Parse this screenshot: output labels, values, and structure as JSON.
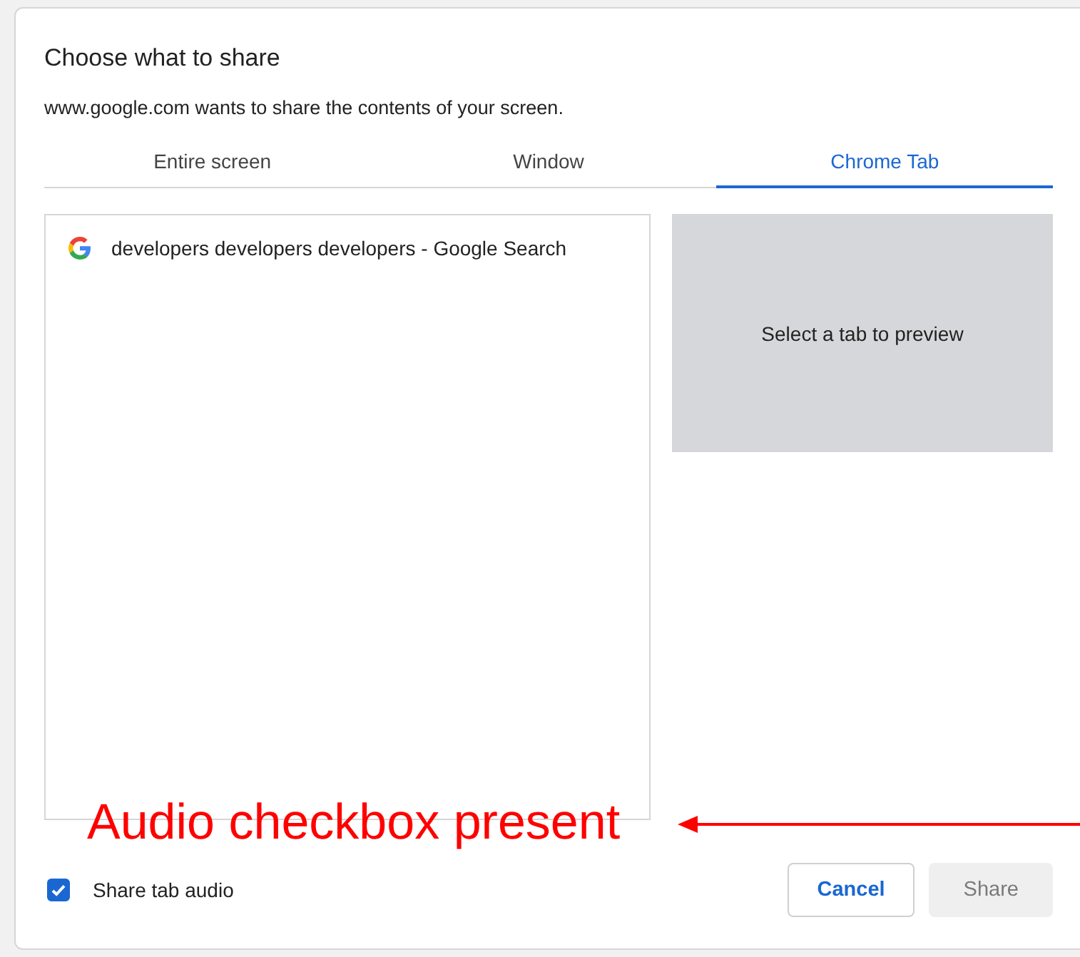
{
  "dialog": {
    "title": "Choose what to share",
    "subtitle": "www.google.com wants to share the contents of your screen."
  },
  "tabs": [
    {
      "label": "Entire screen",
      "selected": false
    },
    {
      "label": "Window",
      "selected": false
    },
    {
      "label": "Chrome Tab",
      "selected": true
    }
  ],
  "tab_list": [
    {
      "title": "developers developers developers - Google Search",
      "selected": false
    }
  ],
  "preview": {
    "text": "Select a tab to preview"
  },
  "audio": {
    "label": "Share tab audio",
    "checked": true
  },
  "buttons": [
    {
      "label": "Cancel",
      "kind": "secondary",
      "disabled": false
    },
    {
      "label": "Share",
      "kind": "primary",
      "disabled": true
    }
  ],
  "annotation": {
    "text": "Audio checkbox present"
  }
}
